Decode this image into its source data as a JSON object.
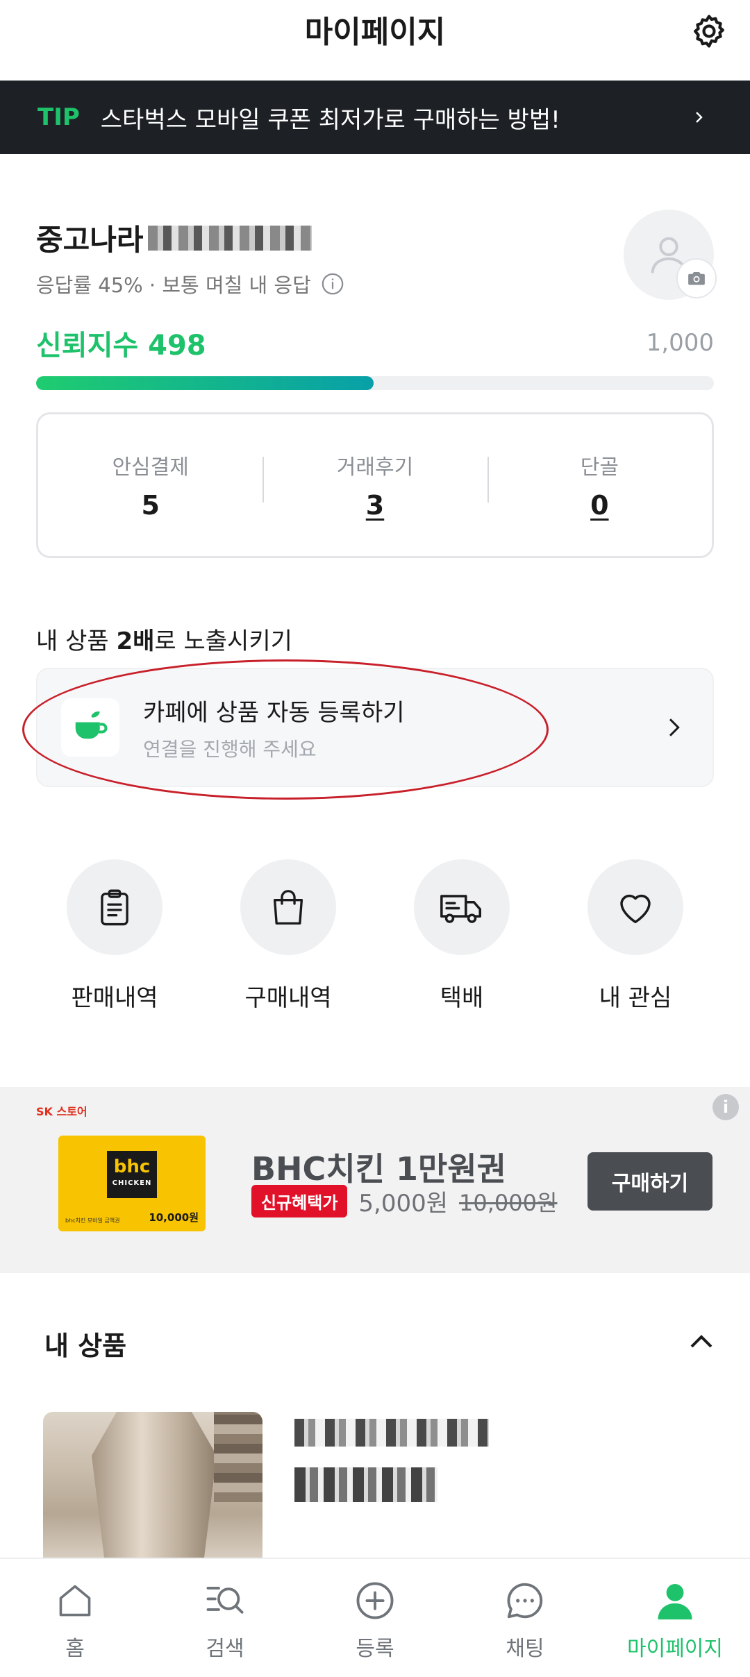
{
  "header": {
    "title": "마이페이지",
    "settings_icon": "gear-icon"
  },
  "tip": {
    "tag": "TIP",
    "text": "스타벅스 모바일 쿠폰 최저가로 구매하는 방법!"
  },
  "profile": {
    "name_prefix": "중고나라",
    "response": "응답률 45% · 보통 며칠 내 응답",
    "trust_label": "신뢰지수 498",
    "trust_max": "1,000",
    "trust_score": 498,
    "trust_fraction": 0.498
  },
  "stats": [
    {
      "label": "안심결제",
      "value": "5"
    },
    {
      "label": "거래후기",
      "value": "3"
    },
    {
      "label": "단골",
      "value": "0"
    }
  ],
  "promo": {
    "title_pre": "내 상품 ",
    "title_bold": "2배",
    "title_post": "로 노출시키기",
    "cafe_title": "카페에 상품 자동 등록하기",
    "cafe_sub": "연결을 진행해 주세요"
  },
  "quick_menu": [
    {
      "label": "판매내역",
      "icon": "clipboard-icon"
    },
    {
      "label": "구매내역",
      "icon": "shopping-bag-icon"
    },
    {
      "label": "택배",
      "icon": "delivery-truck-icon"
    },
    {
      "label": "내 관심",
      "icon": "heart-icon"
    }
  ],
  "ad": {
    "brand": "SK 스토어",
    "card_logo": "bhc",
    "card_logo_sub": "CHICKEN",
    "card_small": "bhc치킨 모바일 금액권",
    "card_price": "10,000원",
    "title": "BHC치킨 1만원권",
    "badge": "신규혜택가",
    "price": "5,000원",
    "old_price": "10,000원",
    "button": "구매하기",
    "info": "i"
  },
  "my_products": {
    "title": "내 상품"
  },
  "bottom_nav": [
    {
      "label": "홈",
      "icon": "home-icon"
    },
    {
      "label": "검색",
      "icon": "search-icon"
    },
    {
      "label": "등록",
      "icon": "plus-circle-icon"
    },
    {
      "label": "채팅",
      "icon": "chat-icon"
    },
    {
      "label": "마이페이지",
      "icon": "person-icon",
      "active": true
    }
  ],
  "colors": {
    "brand_green": "#1ec26b",
    "tip_bg": "#1d2126",
    "highlight_red": "#c8202a"
  }
}
